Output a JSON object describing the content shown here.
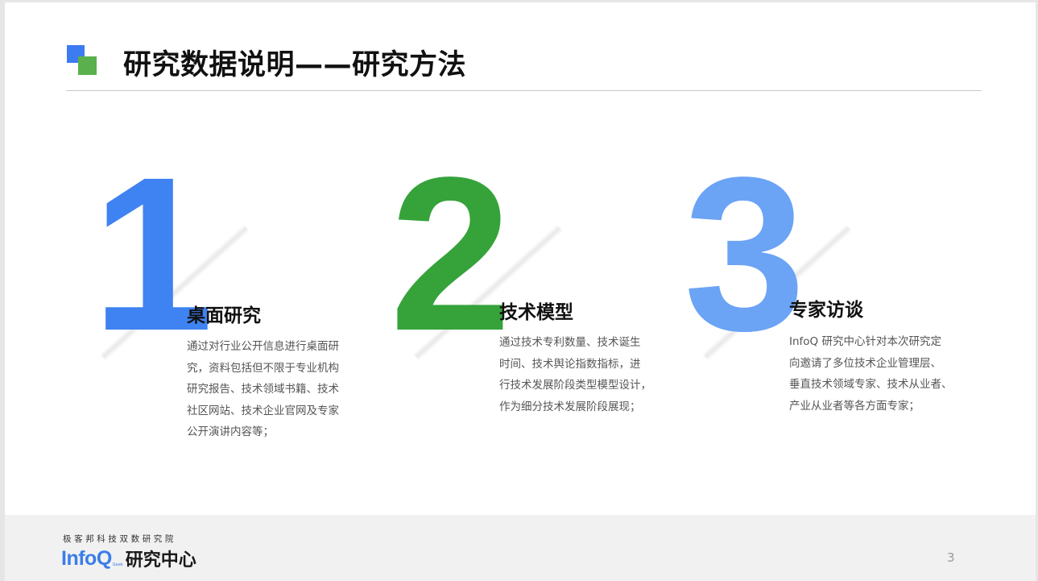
{
  "title": "研究数据说明——研究方法",
  "sections": [
    {
      "number": "1",
      "heading": "桌面研究",
      "lines": [
        "通过对行业公开信息进行桌面研",
        "究，资料包括但不限于专业机构",
        "研究报告、技术领域书籍、技术",
        "社区网站、技术企业官网及专家",
        "公开演讲内容等；"
      ]
    },
    {
      "number": "2",
      "heading": "技术模型",
      "lines": [
        "通过技术专利数量、技术诞生",
        "时间、技术舆论指数指标，进",
        "行技术发展阶段类型模型设计，",
        "作为细分技术发展阶段展现；"
      ]
    },
    {
      "number": "3",
      "heading": "专家访谈",
      "lines": [
        "InfoQ 研究中心针对本次研究定",
        "向邀请了多位技术企业管理层、",
        "垂直技术领域专家、技术从业者、",
        "产业从业者等各方面专家；"
      ]
    }
  ],
  "footer": {
    "org_name": "极客邦科技双数研究院",
    "logo_brand": "InfoQ",
    "logo_tiny": "Geek",
    "logo_center": "研究中心",
    "page_number": "3"
  },
  "colors": {
    "blue": "#3f82f1",
    "green": "#35a33a",
    "light_blue": "#6ba3f5"
  },
  "icons": [
    "title-squares-icon"
  ]
}
